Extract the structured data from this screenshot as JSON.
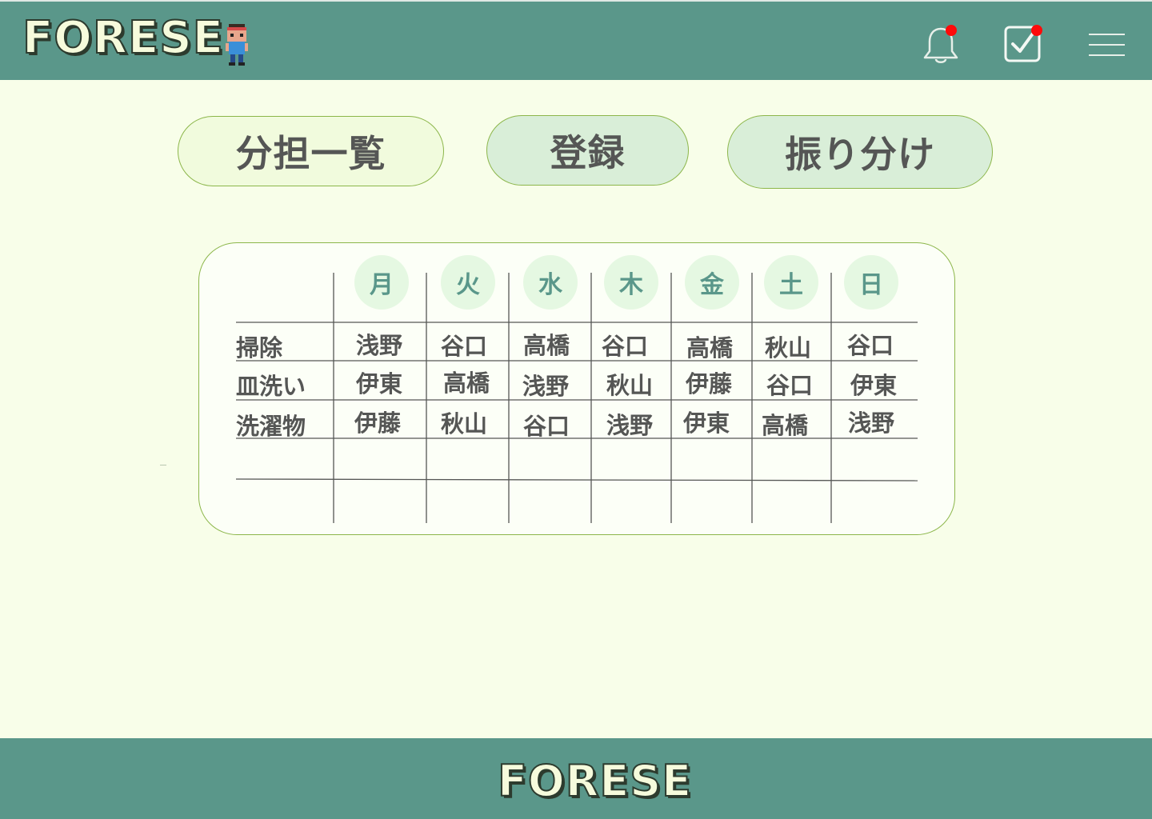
{
  "header": {
    "logo": "FORESE",
    "bell_has_badge": true,
    "tasks_has_badge": true
  },
  "tabs": [
    {
      "label": "分担一覧"
    },
    {
      "label": "登録"
    },
    {
      "label": "振り分け"
    }
  ],
  "schedule": {
    "days": [
      "月",
      "火",
      "水",
      "木",
      "金",
      "土",
      "日"
    ],
    "rows": [
      {
        "chore": "掃除",
        "assignees": [
          "浅野",
          "谷口",
          "高橋",
          "谷口",
          "高橋",
          "秋山",
          "谷口"
        ]
      },
      {
        "chore": "皿洗い",
        "assignees": [
          "伊東",
          "高橋",
          "浅野",
          "秋山",
          "伊藤",
          "谷口",
          "伊東"
        ]
      },
      {
        "chore": "洗濯物",
        "assignees": [
          "伊藤",
          "秋山",
          "谷口",
          "浅野",
          "伊東",
          "高橋",
          "浅野"
        ]
      }
    ]
  },
  "footer": {
    "logo": "FORESE"
  },
  "colors": {
    "header_bg": "#5a978a",
    "page_bg": "#f8fee9",
    "badge": "#ff0a0a",
    "tab_border": "#8cb64a",
    "text": "#555655",
    "day_text": "#5a978a"
  }
}
